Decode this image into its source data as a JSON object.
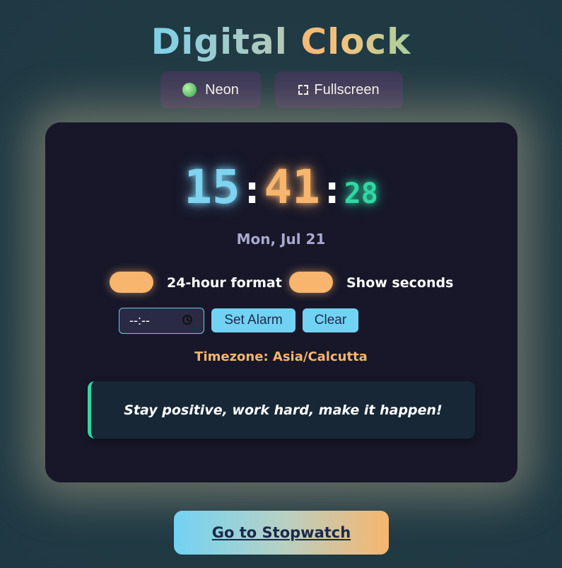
{
  "header": {
    "title_part1": "Digital",
    "title_part2": "Clock"
  },
  "controls": {
    "neon_label": "Neon",
    "fullscreen_label": "Fullscreen"
  },
  "clock": {
    "hours": "15",
    "separator": ":",
    "minutes": "41",
    "seconds": "28",
    "date": "Mon, Jul 21"
  },
  "settings": {
    "format_label": "24-hour format",
    "format_on": true,
    "seconds_label": "Show seconds",
    "seconds_on": true
  },
  "alarm": {
    "input_value": "--:--",
    "set_label": "Set Alarm",
    "clear_label": "Clear"
  },
  "timezone": "Timezone: Asia/Calcutta",
  "quote": "Stay positive, work hard, make it happen!",
  "nav": {
    "stopwatch_label": "Go to Stopwatch"
  },
  "colors": {
    "card_bg": "#171729",
    "accent_blue": "#7dd3f0",
    "accent_orange": "#f7b56d",
    "accent_green": "#30d8a4"
  },
  "icons": {
    "neon": "neon-dot-icon",
    "fullscreen": "fullscreen-icon",
    "alarm_time": "clock-icon"
  }
}
